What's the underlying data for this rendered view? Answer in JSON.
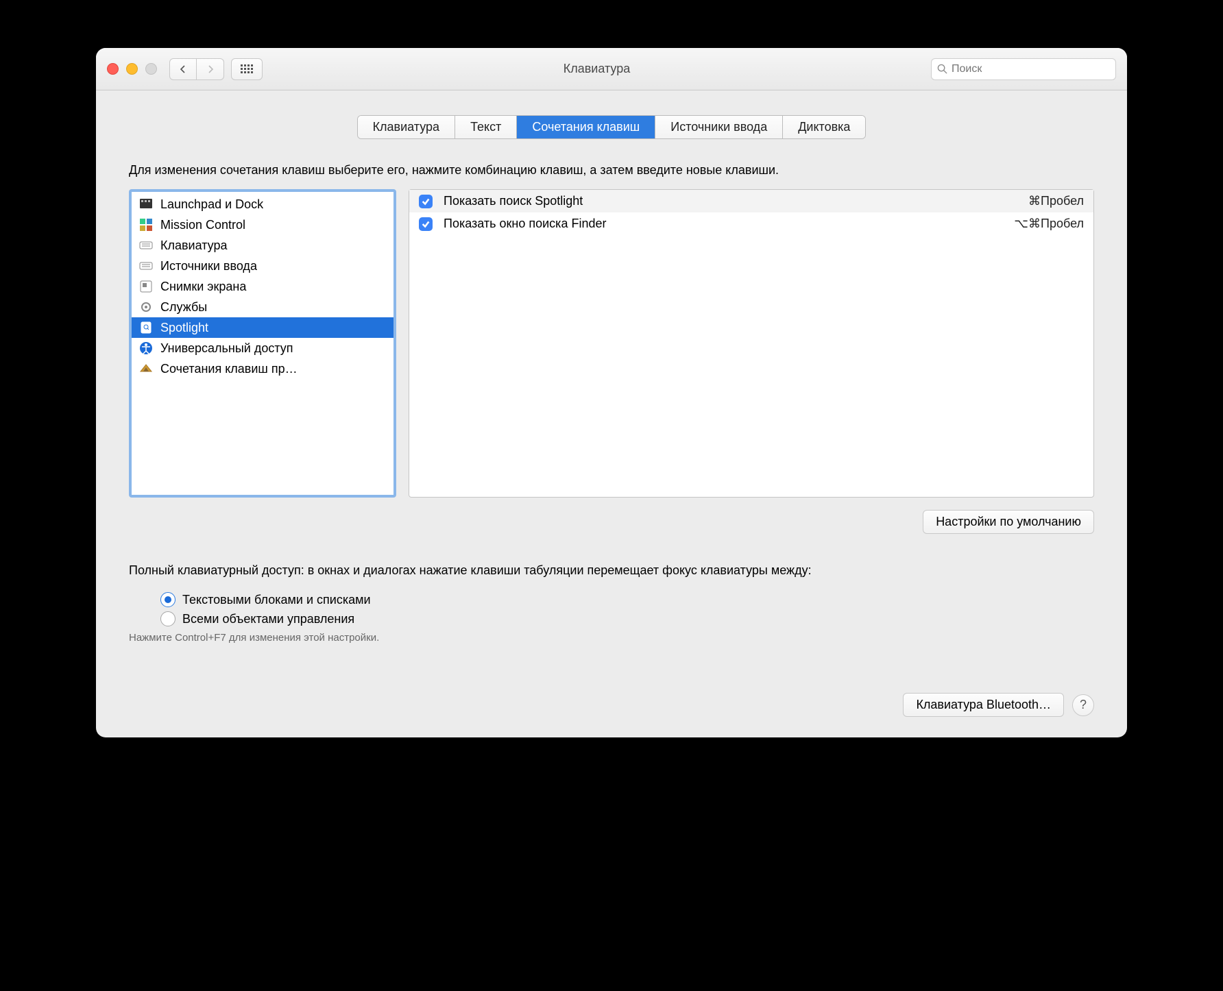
{
  "header": {
    "title": "Клавиатура",
    "search_placeholder": "Поиск"
  },
  "tabs": [
    "Клавиатура",
    "Текст",
    "Сочетания клавиш",
    "Источники ввода",
    "Диктовка"
  ],
  "active_tab_index": 2,
  "instruction": "Для изменения сочетания клавиш выберите его, нажмите комбинацию клавиш, а затем введите новые клавиши.",
  "categories": [
    {
      "label": "Launchpad и Dock",
      "icon": "launchpad"
    },
    {
      "label": "Mission Control",
      "icon": "mission"
    },
    {
      "label": "Клавиатура",
      "icon": "keyboard"
    },
    {
      "label": "Источники ввода",
      "icon": "keyboard"
    },
    {
      "label": "Снимки экрана",
      "icon": "screenshot"
    },
    {
      "label": "Службы",
      "icon": "gear"
    },
    {
      "label": "Spotlight",
      "icon": "spotlight"
    },
    {
      "label": "Универсальный доступ",
      "icon": "accessibility"
    },
    {
      "label": "Сочетания клавиш пр…",
      "icon": "apps"
    }
  ],
  "selected_category_index": 6,
  "shortcuts": [
    {
      "checked": true,
      "label": "Показать поиск Spotlight",
      "shortcut": "⌘Пробел"
    },
    {
      "checked": true,
      "label": "Показать окно поиска Finder",
      "shortcut": "⌥⌘Пробел"
    }
  ],
  "defaults_button": "Настройки по умолчанию",
  "access_description": "Полный клавиатурный доступ: в окнах и диалогах нажатие клавиши табуляции перемещает фокус клавиатуры между:",
  "radio_options": [
    "Текстовыми блоками и списками",
    "Всеми объектами управления"
  ],
  "selected_radio_index": 0,
  "hint": "Нажмите Control+F7 для изменения этой настройки.",
  "bluetooth_button": "Клавиатура Bluetooth…",
  "help_label": "?"
}
